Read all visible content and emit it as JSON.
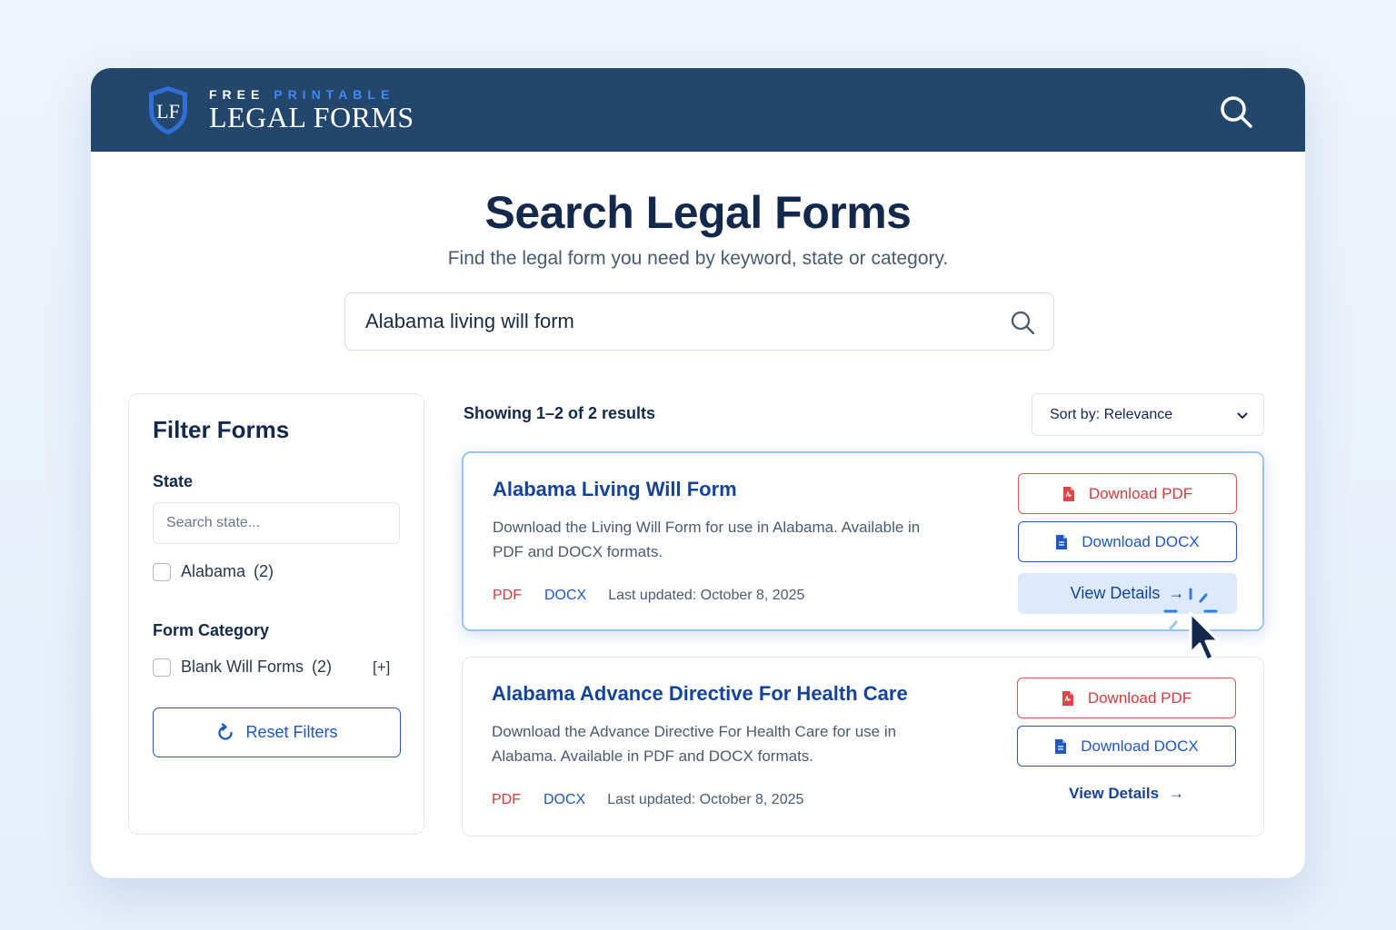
{
  "header": {
    "logo_small_1": "FREE",
    "logo_small_2": "PRINTABLE",
    "logo_big": "LEGAL FORMS",
    "logo_monogram": "LF",
    "search_icon": "search-icon"
  },
  "page": {
    "title": "Search Legal Forms",
    "subtitle": "Find the legal form you need by keyword, state or category."
  },
  "search": {
    "value": "Alabama living will form",
    "icon": "search-icon"
  },
  "filters": {
    "title": "Filter Forms",
    "state_label": "State",
    "state_placeholder": "Search state...",
    "states": [
      {
        "label": "Alabama",
        "count": "(2)",
        "checked": false
      }
    ],
    "category_label": "Form Category",
    "categories": [
      {
        "label": "Blank Will Forms",
        "count": "(2)",
        "expand": "[+]",
        "checked": false
      }
    ],
    "reset_label": "Reset Filters"
  },
  "results": {
    "count_text": "Showing 1–2 of 2 results",
    "sort_label": "Sort by: Relevance",
    "items": [
      {
        "title": "Alabama Living Will Form",
        "description": "Download the Living Will Form for use in Alabama. Available in PDF and DOCX formats.",
        "tag_pdf": "PDF",
        "tag_docx": "DOCX",
        "updated": "Last updated: October 8, 2025",
        "download_pdf": "Download PDF",
        "download_docx": "Download DOCX",
        "view_details": "View Details",
        "arrow": "→"
      },
      {
        "title": "Alabama Advance Directive For Health Care",
        "description": "Download the Advance Directive For Health Care for use in Alabama. Available in PDF and DOCX formats.",
        "tag_pdf": "PDF",
        "tag_docx": "DOCX",
        "updated": "Last updated: October 8, 2025",
        "download_pdf": "Download PDF",
        "download_docx": "Download DOCX",
        "view_details": "View Details",
        "arrow": "→"
      }
    ]
  },
  "colors": {
    "topbar": "#23466d",
    "accent_blue": "#1f57c4",
    "pdf_red": "#d63a3a",
    "title_navy": "#13294b"
  }
}
